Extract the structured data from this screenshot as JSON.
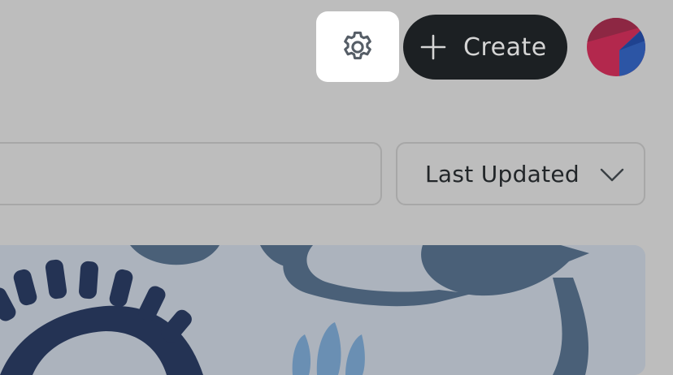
{
  "header": {
    "settings_icon": "gear-icon",
    "create_button": {
      "icon": "plus-icon",
      "label": "Create"
    },
    "avatar": {
      "colors": [
        "#8d2743",
        "#b3284d",
        "#2c55a5"
      ]
    }
  },
  "filters": {
    "search": {
      "value": "",
      "placeholder": ""
    },
    "sort": {
      "selected": "Last Updated",
      "icon": "chevron-down-icon"
    }
  },
  "card": {
    "thumbnail_colors": [
      "#acb3bd",
      "#243354",
      "#4a6078",
      "#6a8fb3"
    ]
  },
  "colors": {
    "background": "#bdbdbd",
    "create_button_bg": "#1c2023",
    "settings_button_bg": "#ffffff",
    "border": "#a7a7a7"
  }
}
